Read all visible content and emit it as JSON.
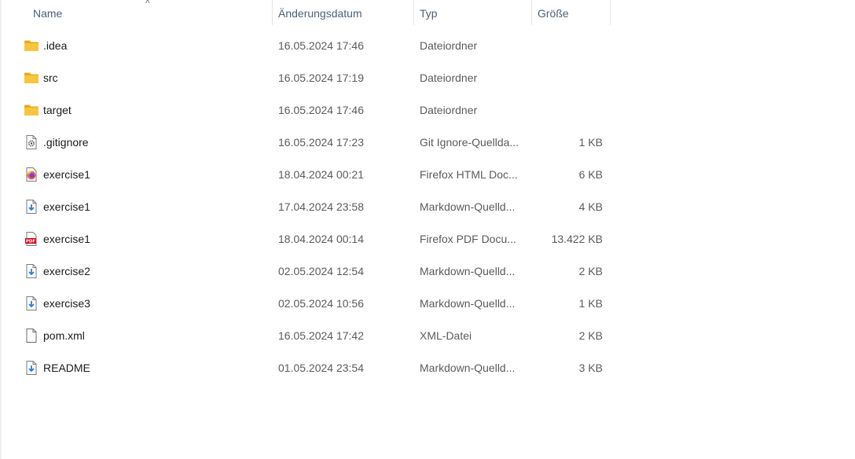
{
  "header": {
    "name": "Name",
    "date": "Änderungsdatum",
    "type": "Typ",
    "size": "Größe",
    "sort_indicator": "^"
  },
  "files": [
    {
      "name": ".idea",
      "date": "16.05.2024 17:46",
      "type": "Dateiordner",
      "size": "",
      "icon": "folder-icon"
    },
    {
      "name": "src",
      "date": "16.05.2024 17:19",
      "type": "Dateiordner",
      "size": "",
      "icon": "folder-icon"
    },
    {
      "name": "target",
      "date": "16.05.2024 17:46",
      "type": "Dateiordner",
      "size": "",
      "icon": "folder-icon"
    },
    {
      "name": ".gitignore",
      "date": "16.05.2024 17:23",
      "type": "Git Ignore-Quellda...",
      "size": "1 KB",
      "icon": "gear-file-icon"
    },
    {
      "name": "exercise1",
      "date": "18.04.2024 00:21",
      "type": "Firefox HTML Doc...",
      "size": "6 KB",
      "icon": "firefox-html-icon"
    },
    {
      "name": "exercise1",
      "date": "17.04.2024 23:58",
      "type": "Markdown-Quelld...",
      "size": "4 KB",
      "icon": "markdown-file-icon"
    },
    {
      "name": "exercise1",
      "date": "18.04.2024 00:14",
      "type": "Firefox PDF Docu...",
      "size": "13.422 KB",
      "icon": "pdf-file-icon"
    },
    {
      "name": "exercise2",
      "date": "02.05.2024 12:54",
      "type": "Markdown-Quelld...",
      "size": "2 KB",
      "icon": "markdown-file-icon"
    },
    {
      "name": "exercise3",
      "date": "02.05.2024 10:56",
      "type": "Markdown-Quelld...",
      "size": "1 KB",
      "icon": "markdown-file-icon"
    },
    {
      "name": "pom.xml",
      "date": "16.05.2024 17:42",
      "type": "XML-Datei",
      "size": "2 KB",
      "icon": "blank-file-icon"
    },
    {
      "name": "README",
      "date": "01.05.2024 23:54",
      "type": "Markdown-Quelld...",
      "size": "3 KB",
      "icon": "markdown-file-icon"
    }
  ],
  "colors": {
    "folder": "#f5c542",
    "folder_dark": "#e6ac1e",
    "header_text": "#4c607a",
    "pdf_red": "#d0021b",
    "markdown_blue": "#2b7cd3"
  }
}
